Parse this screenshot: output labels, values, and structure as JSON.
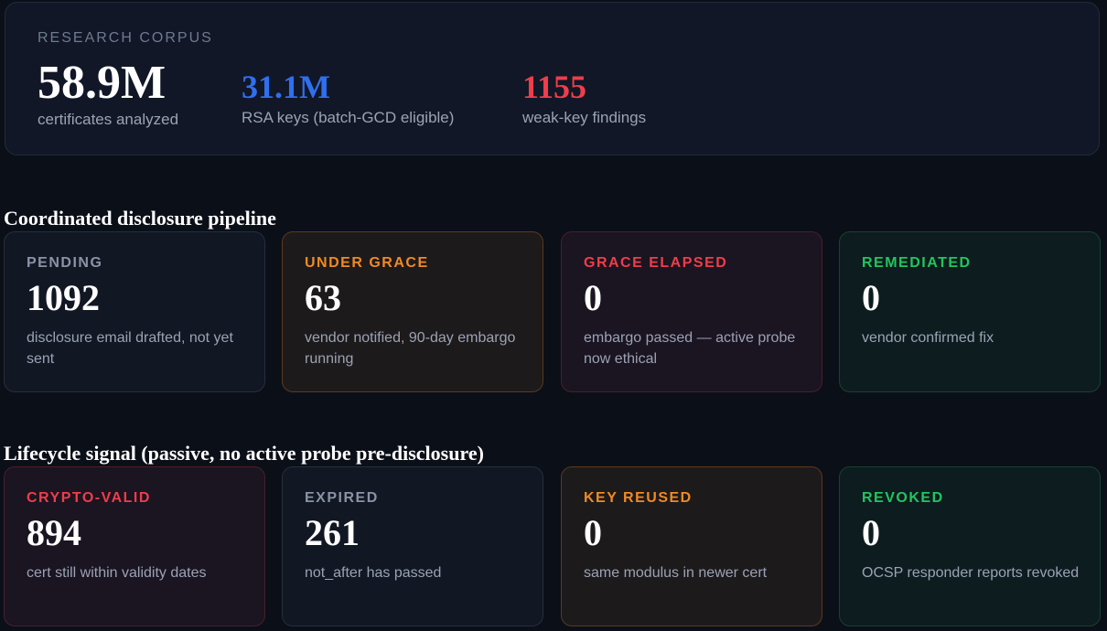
{
  "corpus": {
    "eyebrow": "RESEARCH CORPUS",
    "metrics": [
      {
        "value": "58.9M",
        "label": "certificates analyzed",
        "color": "#ffffff"
      },
      {
        "value": "31.1M",
        "label": "RSA keys (batch-GCD eligible)",
        "color": "#2f6ff0"
      },
      {
        "value": "1155",
        "label": "weak-key findings",
        "color": "#ef3d4a"
      }
    ]
  },
  "pipeline": {
    "title": "Coordinated disclosure pipeline",
    "cards": [
      {
        "label": "PENDING",
        "value": "1092",
        "desc": "disclosure email drafted, not yet sent",
        "tone": "neutral"
      },
      {
        "label": "UNDER GRACE",
        "value": "63",
        "desc": "vendor notified, 90-day embargo running",
        "tone": "orange"
      },
      {
        "label": "GRACE ELAPSED",
        "value": "0",
        "desc": "embargo passed — active probe now ethical",
        "tone": "red"
      },
      {
        "label": "REMEDIATED",
        "value": "0",
        "desc": "vendor confirmed fix",
        "tone": "green"
      }
    ]
  },
  "lifecycle": {
    "title": "Lifecycle signal (passive, no active probe pre-disclosure)",
    "cards": [
      {
        "label": "CRYPTO-VALID",
        "value": "894",
        "desc": "cert still within validity dates",
        "tone": "red"
      },
      {
        "label": "EXPIRED",
        "value": "261",
        "desc": "not_after has passed",
        "tone": "neutral"
      },
      {
        "label": "KEY REUSED",
        "value": "0",
        "desc": "same modulus in newer cert",
        "tone": "orange"
      },
      {
        "label": "REVOKED",
        "value": "0",
        "desc": "OCSP responder reports revoked",
        "tone": "green"
      }
    ]
  },
  "colors": {
    "background": "#0b0f18",
    "neutral": "#8a93a6",
    "orange": "#f08a24",
    "red": "#ef3d4a",
    "green": "#22c55e",
    "blue": "#2f6ff0"
  }
}
